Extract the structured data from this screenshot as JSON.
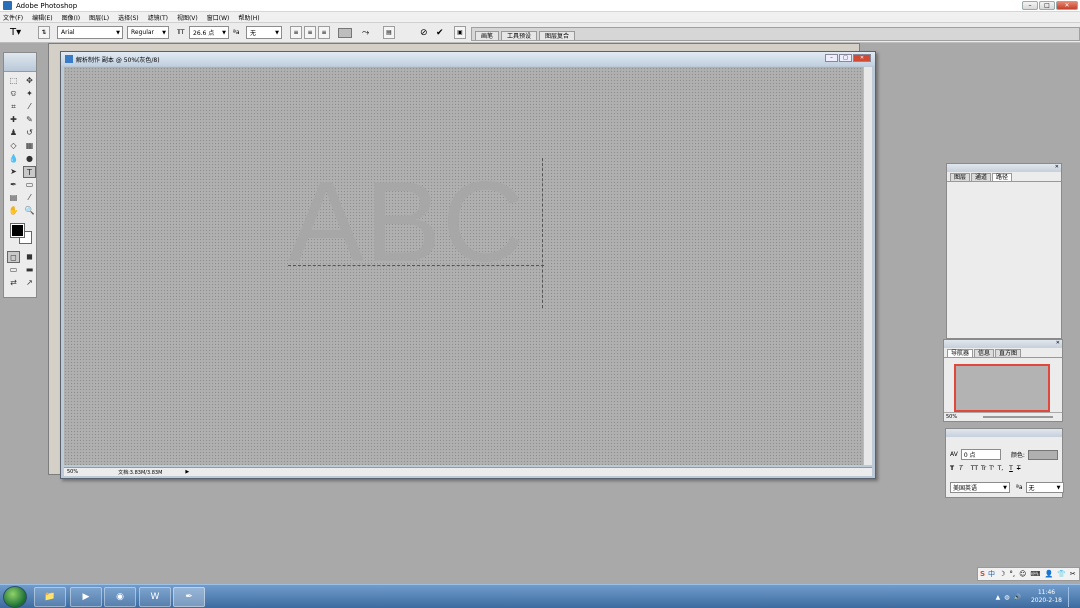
{
  "window": {
    "title": "Adobe Photoshop"
  },
  "menu": [
    "文件(F)",
    "编辑(E)",
    "图像(I)",
    "图层(L)",
    "选择(S)",
    "滤镜(T)",
    "视图(V)",
    "窗口(W)",
    "帮助(H)"
  ],
  "options": {
    "font_family": "Arial",
    "font_style": "Regular",
    "font_size": "26.6 点",
    "antialias": "无",
    "palette_tabs": [
      "画笔",
      "工具预设",
      "图层复合"
    ]
  },
  "document": {
    "title": "解析制作 副本 @ 50%(灰色/8)",
    "canvas_text": "ABC",
    "zoom": "50%",
    "doc_size": "文档:3.83M/3.83M"
  },
  "layers_panel": {
    "tabs": [
      "图层",
      "通道",
      "路径"
    ]
  },
  "navigator_panel": {
    "tabs": [
      "导航器",
      "信息",
      "直方图"
    ],
    "zoom": "50%"
  },
  "character_panel": {
    "tracking": "0 点",
    "color_label": "颜色:",
    "language": "美国英语",
    "antialias": "无",
    "style_buttons": [
      "T",
      "T",
      "TT",
      "Tr",
      "T'",
      "T,",
      "T",
      "T"
    ]
  },
  "taskbar": {
    "time": "11:46",
    "date": "2020-2-18",
    "apps": [
      "folder",
      "media",
      "browser",
      "word",
      "photoshop"
    ]
  }
}
